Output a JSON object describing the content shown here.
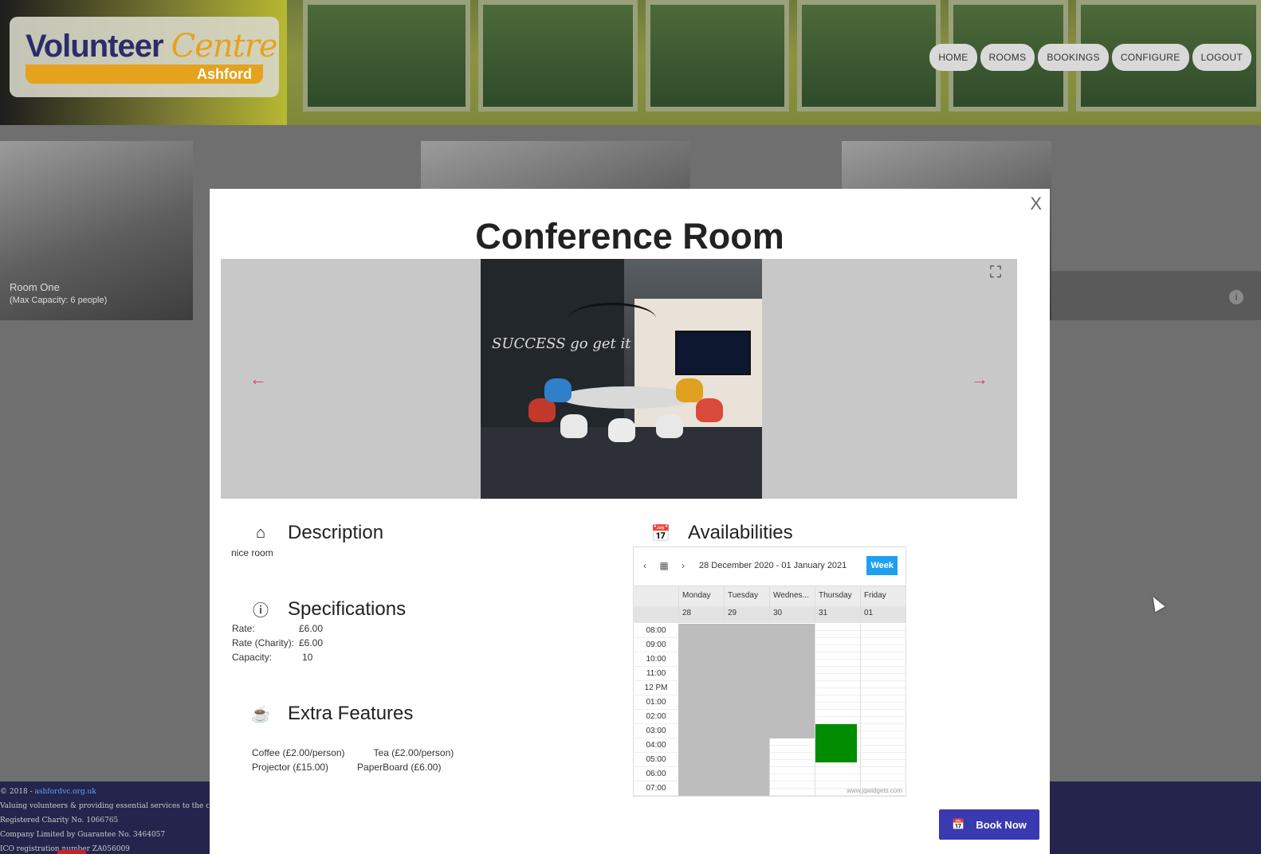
{
  "header": {
    "logo_main": "Volunteer",
    "logo_accent": "Centre",
    "logo_sub": "Ashford",
    "nav": [
      {
        "label": "HOME",
        "icon": "home"
      },
      {
        "label": "ROOMS",
        "icon": "rooms"
      },
      {
        "label": "BOOKINGS",
        "icon": "bookings"
      },
      {
        "label": "CONFIGURE",
        "icon": "configure"
      },
      {
        "label": "LOGOUT",
        "icon": "logout"
      }
    ]
  },
  "background": {
    "room_card": {
      "name": "Room One",
      "capacity": "(Max Capacity: 6 people)"
    },
    "info_icon": "i"
  },
  "footer": {
    "copyright_prefix": "© 2018 - ",
    "copyright_link": "ashfordvc.org.uk",
    "lines": [
      "Valuing volunteers & providing essential services to the community of Ashford",
      "Registered Charity No. 1066765",
      "Company Limited by Guarantee No. 3464057",
      "ICO registration number ZA056009"
    ]
  },
  "modal": {
    "close_label": "X",
    "title": "Conference Room",
    "gallery": {
      "prev_icon": "arrow-left",
      "next_icon": "arrow-right",
      "fullscreen_icon": "expand",
      "photo_caption": "SUCCESS go get it"
    },
    "description": {
      "heading": "Description",
      "text": "nice room",
      "icon": "home-icon"
    },
    "specifications": {
      "heading": "Specifications",
      "icon": "info-icon",
      "rows": [
        {
          "label": "Rate:",
          "value": "£6.00"
        },
        {
          "label": "Rate (Charity):",
          "value": "£6.00"
        },
        {
          "label": "Capacity:",
          "value": "10"
        }
      ]
    },
    "extras": {
      "heading": "Extra Features",
      "icon": "coffee-icon",
      "items": [
        "Coffee (£2.00/person)",
        "Tea (£2.00/person)",
        "Projector (£15.00)",
        "PaperBoard (£6.00)"
      ]
    },
    "availability": {
      "heading": "Availabilities",
      "icon": "calendar-icon",
      "range": "28 December 2020 - 01 January 2021",
      "view_button": "Week",
      "days": [
        "Monday",
        "Tuesday",
        "Wednes...",
        "Thursday",
        "Friday"
      ],
      "dates": [
        "28",
        "29",
        "30",
        "31",
        "01"
      ],
      "times": [
        "08:00",
        "09:00",
        "10:00",
        "11:00",
        "12 PM",
        "01:00",
        "02:00",
        "03:00",
        "04:00",
        "05:00",
        "06:00",
        "07:00"
      ],
      "watermark": "www.jqwidgets.com",
      "blocked_color": "#bdbdbd",
      "booked_color": "#008c00"
    },
    "book_button": "Book Now"
  }
}
